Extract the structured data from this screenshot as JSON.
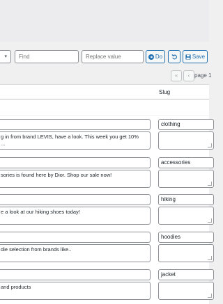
{
  "toolbar": {
    "find_placeholder": "Find",
    "replace_placeholder": "Replace value",
    "do_label": "Do",
    "save_label": "Save"
  },
  "pagination": {
    "first_label": "«",
    "prev_label": "‹",
    "page_text": "page 1"
  },
  "table": {
    "slug_header": "Slug",
    "rows": [
      {
        "description": "g in from brand LEVIS, have a look. This week you get 10%\n...",
        "slug": "clothing"
      },
      {
        "description": "sories is found here by Dior. Shop our sale now!",
        "slug": "accessories"
      },
      {
        "description": "e a look at our hiking shoes today!",
        "slug": "hiking"
      },
      {
        "description": "die selection from brands like..",
        "slug": "hoodies"
      },
      {
        "description": "and products",
        "slug": "jacket"
      }
    ]
  },
  "colors": {
    "accent": "#2271b1",
    "border": "#8c8f94",
    "background": "#f0f0f1"
  }
}
